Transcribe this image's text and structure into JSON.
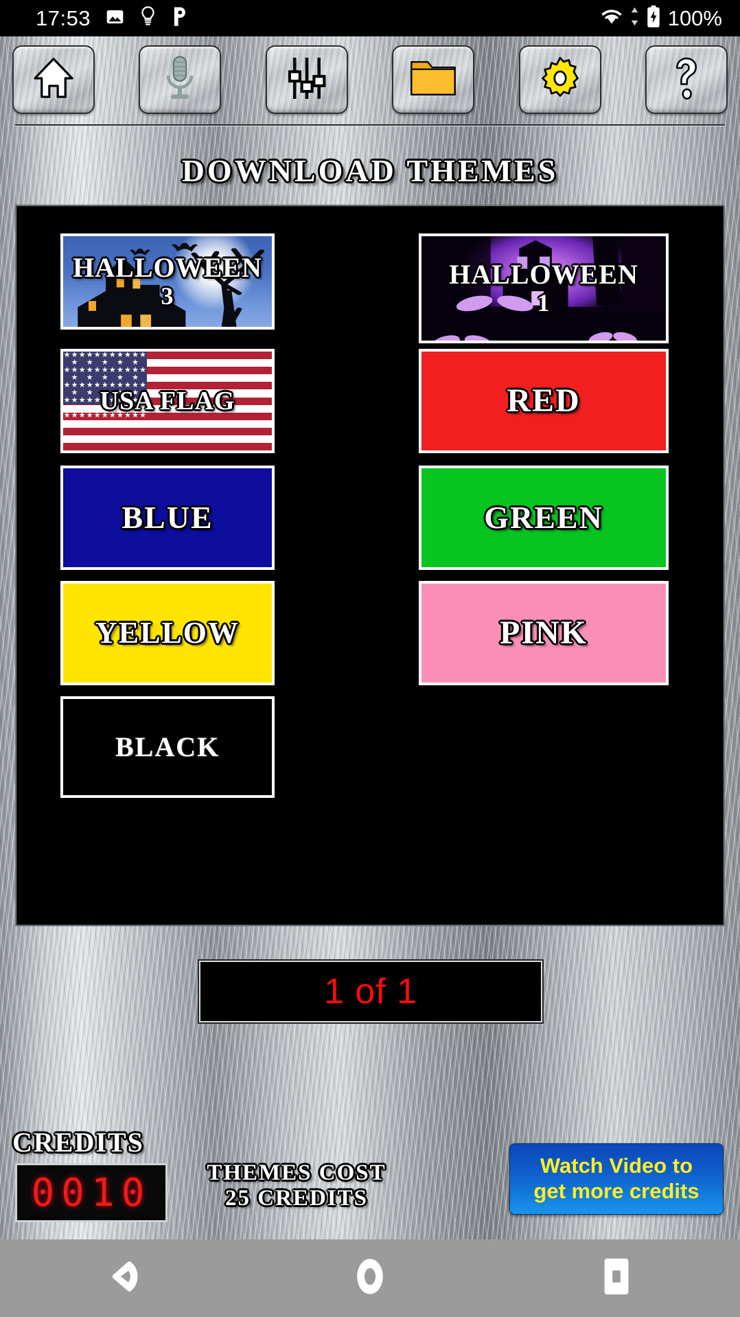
{
  "status_bar": {
    "time": "17:53",
    "battery_percent": "100%",
    "icons": [
      "image-icon",
      "lightbulb-icon",
      "p-app-icon",
      "wifi-icon",
      "data-transfer-icon",
      "battery-charging-icon"
    ]
  },
  "toolbar": {
    "buttons": [
      {
        "name": "home-button",
        "icon": "home-icon"
      },
      {
        "name": "microphone-button",
        "icon": "microphone-icon"
      },
      {
        "name": "equalizer-button",
        "icon": "equalizer-sliders-icon"
      },
      {
        "name": "folder-button",
        "icon": "folder-icon"
      },
      {
        "name": "settings-button",
        "icon": "gear-icon"
      },
      {
        "name": "help-button",
        "icon": "question-mark-icon"
      }
    ]
  },
  "page": {
    "title": "DOWNLOAD THEMES"
  },
  "themes": [
    {
      "label": "HALLOWEEN",
      "sublabel": "3",
      "art": "halloween3",
      "color": "#3c63b4",
      "column": "left",
      "row": 0
    },
    {
      "label": "HALLOWEEN",
      "sublabel": "1",
      "art": "halloween1",
      "color": "#2a0a4d",
      "column": "right",
      "row": 0
    },
    {
      "label": "USA FLAG",
      "sublabel": "",
      "art": "usaflag",
      "color": "#b22234",
      "column": "left",
      "row": 1
    },
    {
      "label": "RED",
      "sublabel": "",
      "art": "solid",
      "color": "#f11f20",
      "column": "right",
      "row": 1
    },
    {
      "label": "BLUE",
      "sublabel": "",
      "art": "solid",
      "color": "#0d0d9e",
      "column": "left",
      "row": 2
    },
    {
      "label": "GREEN",
      "sublabel": "",
      "art": "solid",
      "color": "#06c521",
      "column": "right",
      "row": 2
    },
    {
      "label": "YELLOW",
      "sublabel": "",
      "art": "solid",
      "color": "#ffe500",
      "column": "left",
      "row": 3
    },
    {
      "label": "PINK",
      "sublabel": "",
      "art": "solid",
      "color": "#f98fb7",
      "column": "right",
      "row": 3
    },
    {
      "label": "BLACK",
      "sublabel": "",
      "art": "solid",
      "color": "#000000",
      "column": "left",
      "row": 4
    }
  ],
  "pagination": {
    "text": "1 of 1"
  },
  "credits": {
    "label": "CREDITS",
    "value": "0010",
    "cost_line1": "THEMES COST",
    "cost_line2": "25 CREDITS"
  },
  "watch_video": {
    "line1": "Watch Video to",
    "line2": "get more credits"
  },
  "nav_bar": {
    "back": "back-triangle-icon",
    "home": "home-circle-icon",
    "recents": "recents-square-icon"
  },
  "colors": {
    "accent_red": "#fb0b0b",
    "accent_yellow": "#ffee22",
    "button_blue": "#0f5cc9",
    "panel_black": "#000000",
    "metal": "#a8adb2"
  }
}
